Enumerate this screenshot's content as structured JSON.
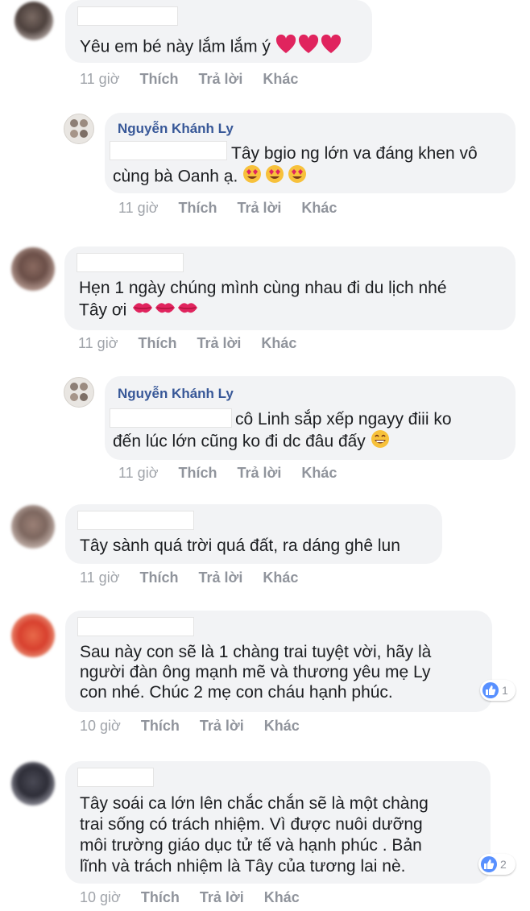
{
  "comments": [
    {
      "text_lines": [
        "Yêu em bé này lắm lắm ý"
      ],
      "time": "11 giờ",
      "like": "Thích",
      "reply": "Trả lời",
      "more": "Khác"
    },
    {
      "author": "Nguyễn Khánh Ly",
      "text_lines": [
        "Tây bgio ng lớn va đáng khen vô",
        "cùng bà Oanh ạ."
      ],
      "time": "11 giờ",
      "like": "Thích",
      "reply": "Trả lời",
      "more": "Khác"
    },
    {
      "text_lines": [
        "Hẹn 1 ngày chúng mình cùng nhau đi du lịch nhé",
        "Tây ơi"
      ],
      "time": "11 giờ",
      "like": "Thích",
      "reply": "Trả lời",
      "more": "Khác"
    },
    {
      "author": "Nguyễn Khánh Ly",
      "text_lines": [
        "cô Linh sắp xếp ngayy điii ko",
        "đến lúc lớn cũng ko đi dc đâu đấy"
      ],
      "time": "11 giờ",
      "like": "Thích",
      "reply": "Trả lời",
      "more": "Khác"
    },
    {
      "text_lines": [
        "Tây sành quá trời quá đất, ra dáng ghê lun"
      ],
      "time": "11 giờ",
      "like": "Thích",
      "reply": "Trả lời",
      "more": "Khác"
    },
    {
      "text_lines": [
        "Sau này con sẽ là 1 chàng trai tuyệt vời, hãy là",
        "người đàn ông mạnh mẽ và thương yêu mẹ Ly",
        "con nhé. Chúc 2 mẹ con cháu hạnh phúc."
      ],
      "time": "10 giờ",
      "like": "Thích",
      "reply": "Trả lời",
      "more": "Khác",
      "reaction_count": "1"
    },
    {
      "text_lines": [
        "Tây soái ca lớn lên chắc chắn sẽ là một chàng",
        "trai sống có trách nhiệm. Vì được nuôi dưỡng",
        "môi trường giáo dục tử tế và hạnh phúc . Bản",
        "lĩnh và trách nhiệm là Tây của tương lai nè."
      ],
      "time": "10 giờ",
      "like": "Thích",
      "reply": "Trả lời",
      "more": "Khác",
      "reaction_count": "2"
    }
  ],
  "icons": {
    "heart": "red-heart-icon",
    "heart_eyes": "heart-eyes-emoji-icon",
    "kiss": "kiss-mark-icon",
    "grin": "grinning-smile-emoji-icon",
    "like": "like-thumb-icon"
  },
  "colors": {
    "bubble": "#f2f3f5",
    "author": "#385898",
    "meta": "#90949c",
    "like_blue": "#5890ff",
    "heart_red": "#e0245e"
  }
}
